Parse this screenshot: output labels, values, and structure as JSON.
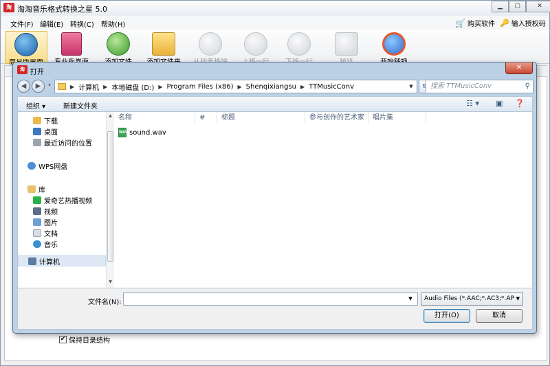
{
  "app": {
    "logo_text": "淘",
    "title": "淘淘音乐格式转换之星 5.0",
    "menus": [
      "文件(F)",
      "编辑(E)",
      "转换(C)",
      "帮助(H)"
    ],
    "buy_label": "购买软件",
    "auth_label": "输入授权码",
    "toolbar": [
      {
        "label": "简易版界面"
      },
      {
        "label": "专业版界面"
      },
      {
        "label": "添加文件"
      },
      {
        "label": "添加文件夹"
      },
      {
        "label": "从列表移除"
      },
      {
        "label": "上移一行"
      },
      {
        "label": "下移一行"
      },
      {
        "label": "预览"
      },
      {
        "label": "开始转换"
      }
    ],
    "keep_structure_label": "保持目录结构"
  },
  "dialog": {
    "title": "打开",
    "logo_text": "淘",
    "close_label": "✕",
    "breadcrumb": [
      "计算机",
      "本地磁盘 (D:)",
      "Program Files (x86)",
      "Shenqixiangsu",
      "TTMusicConv"
    ],
    "search_placeholder": "搜索 TTMusicConv",
    "organize_label": "组织 ▾",
    "new_folder_label": "新建文件夹",
    "nav": {
      "favorites": [
        "下载",
        "桌面",
        "最近访问的位置"
      ],
      "wps": "WPS网盘",
      "library": "库",
      "library_items": [
        "爱奇艺热播视频",
        "视频",
        "图片",
        "文档",
        "音乐"
      ],
      "computer": "计算机"
    },
    "columns": [
      "名称",
      "#",
      "标题",
      "参与创作的艺术家",
      "唱片集"
    ],
    "files": [
      {
        "name": "sound.wav"
      }
    ],
    "filename_label": "文件名(N):",
    "filename_value": "",
    "filter_value": "Audio Files (*.AAC;*.AC3;*.AP",
    "open_label": "打开(O)",
    "cancel_label": "取消"
  }
}
